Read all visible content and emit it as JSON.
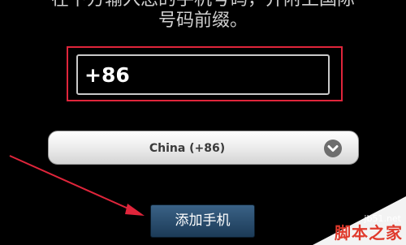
{
  "instruction": {
    "line1": "在下方输入您的手机号码，并附上国际",
    "line2": "号码前缀。"
  },
  "phone_input": {
    "value": "+86"
  },
  "country_select": {
    "selected": "China (+86)"
  },
  "add_phone_button": {
    "label": "添加手机"
  },
  "watermark": {
    "site": "jb51.net",
    "name": "脚本之家"
  },
  "colors": {
    "highlight": "#e0253b",
    "button": "#2a4d6e",
    "background": "#000000"
  },
  "icons": {
    "select": "chevron-down-icon",
    "annotation": "red-arrow-icon"
  }
}
